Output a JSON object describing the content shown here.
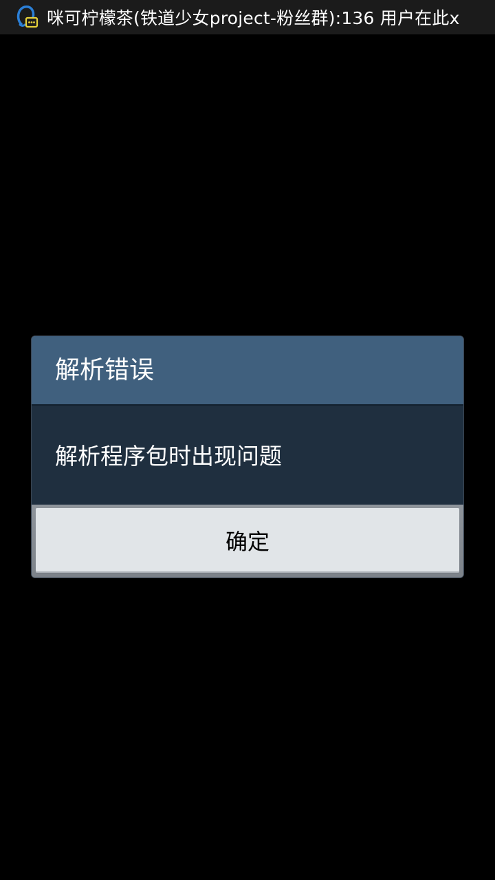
{
  "status_bar": {
    "icon": "qq-message-icon",
    "ticker_text": "咪可柠檬茶(铁道少女project-粉丝群):136 用户在此x"
  },
  "dialog": {
    "title": "解析错误",
    "message": "解析程序包时出现问题",
    "ok_label": "确定"
  },
  "colors": {
    "background": "#000000",
    "status_bar": "#1b1b1b",
    "dialog_title_bg": "#40607e",
    "dialog_body_bg": "#1f2f3f",
    "button_bg": "#e1e5e8"
  }
}
